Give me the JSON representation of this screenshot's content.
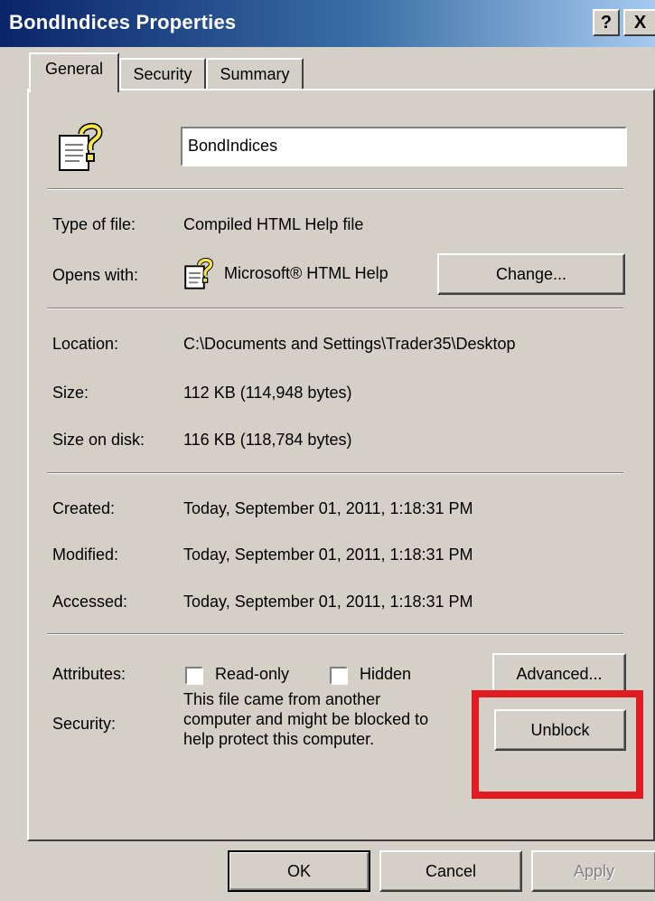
{
  "window": {
    "title": "BondIndices Properties",
    "help_button": "?",
    "close_button": "X"
  },
  "tabs": [
    {
      "label": "General",
      "active": true
    },
    {
      "label": "Security",
      "active": false
    },
    {
      "label": "Summary",
      "active": false
    }
  ],
  "general": {
    "file_icon": "chm-help-file-icon",
    "file_name": "BondIndices",
    "type_of_file_label": "Type of file:",
    "type_of_file_value": "Compiled HTML Help file",
    "opens_with_label": "Opens with:",
    "opens_with_app_icon": "html-help-icon",
    "opens_with_value": "Microsoft® HTML Help",
    "change_button": "Change...",
    "location_label": "Location:",
    "location_value": "C:\\Documents and Settings\\Trader35\\Desktop",
    "size_label": "Size:",
    "size_value": "112 KB (114,948 bytes)",
    "size_on_disk_label": "Size on disk:",
    "size_on_disk_value": "116 KB (118,784 bytes)",
    "created_label": "Created:",
    "created_value": "Today, September 01, 2011, 1:18:31 PM",
    "modified_label": "Modified:",
    "modified_value": "Today, September 01, 2011, 1:18:31 PM",
    "accessed_label": "Accessed:",
    "accessed_value": "Today, September 01, 2011, 1:18:31 PM",
    "attributes_label": "Attributes:",
    "readonly_label": "Read-only",
    "readonly_checked": false,
    "hidden_label": "Hidden",
    "hidden_checked": false,
    "advanced_button": "Advanced...",
    "security_label": "Security:",
    "security_text_line1": "This file came from another",
    "security_text_line2": "computer and might be blocked to",
    "security_text_line3": "help protect this computer.",
    "unblock_button": "Unblock"
  },
  "footer": {
    "ok_button": "OK",
    "cancel_button": "Cancel",
    "apply_button": "Apply",
    "apply_enabled": false
  },
  "colors": {
    "dialog_bg": "#d4d0c8",
    "titlebar_start": "#0a246a",
    "titlebar_end": "#a6caf0",
    "highlight_red": "#e11b22"
  }
}
